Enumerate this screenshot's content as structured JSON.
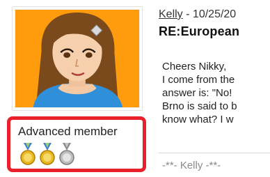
{
  "user": {
    "rank": "Advanced member",
    "medals": [
      {
        "icon": "gold-medal-icon",
        "color": "#e9b923"
      },
      {
        "icon": "gold-medal-icon",
        "color": "#e9b923"
      },
      {
        "icon": "silver-medal-icon",
        "color": "#bdbdbd"
      }
    ]
  },
  "post": {
    "author": "Kelly",
    "separator": "-",
    "date": "10/25/20",
    "title": "RE:European",
    "body": [
      "Cheers Nikky,",
      "I come from the",
      "answer is: \"No!",
      "Brno is said to b",
      "know what? I w"
    ],
    "signature": "-**- Kelly -**-"
  },
  "colors": {
    "highlight": "#e8202a",
    "avatar_background": "#ff9c0d"
  }
}
